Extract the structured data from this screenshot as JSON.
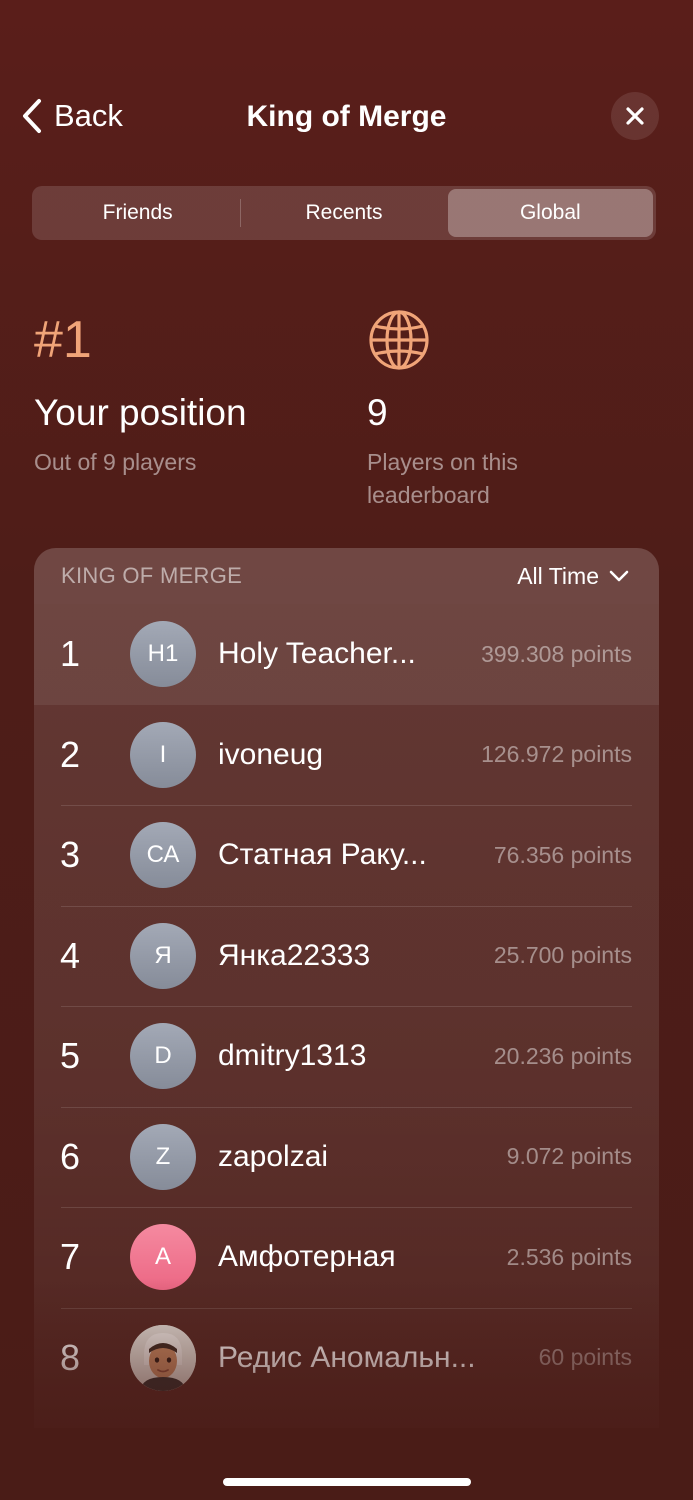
{
  "nav": {
    "back_label": "Back",
    "title": "King of Merge"
  },
  "tabs": [
    {
      "label": "Friends",
      "active": false
    },
    {
      "label": "Recents",
      "active": false
    },
    {
      "label": "Global",
      "active": true
    }
  ],
  "position": {
    "rank": "#1",
    "label": "Your position",
    "sub": "Out of 9 players"
  },
  "players": {
    "icon": "globe-icon",
    "count": "9",
    "sub": "Players on this leaderboard"
  },
  "leaderboard": {
    "title": "KING OF MERGE",
    "filter": "All Time",
    "rows": [
      {
        "rank": "1",
        "initials": "H1",
        "name": "Holy Teacher...",
        "points": "399.308 points",
        "avatar": "gray"
      },
      {
        "rank": "2",
        "initials": "I",
        "name": "ivoneug",
        "points": "126.972 points",
        "avatar": "gray"
      },
      {
        "rank": "3",
        "initials": "СА",
        "name": "Статная Раку...",
        "points": "76.356 points",
        "avatar": "gray"
      },
      {
        "rank": "4",
        "initials": "Я",
        "name": "Янка22333",
        "points": "25.700 points",
        "avatar": "gray"
      },
      {
        "rank": "5",
        "initials": "D",
        "name": "dmitry1313",
        "points": "20.236 points",
        "avatar": "gray"
      },
      {
        "rank": "6",
        "initials": "Z",
        "name": "zapolzai",
        "points": "9.072 points",
        "avatar": "gray"
      },
      {
        "rank": "7",
        "initials": "A",
        "name": "Амфотерная",
        "points": "2.536 points",
        "avatar": "pink"
      },
      {
        "rank": "8",
        "initials": "",
        "name": "Редис Аномальн...",
        "points": "60 points",
        "avatar": "memoji"
      }
    ]
  },
  "colors": {
    "accent": "#f0a478",
    "background": "#4e1d18"
  }
}
